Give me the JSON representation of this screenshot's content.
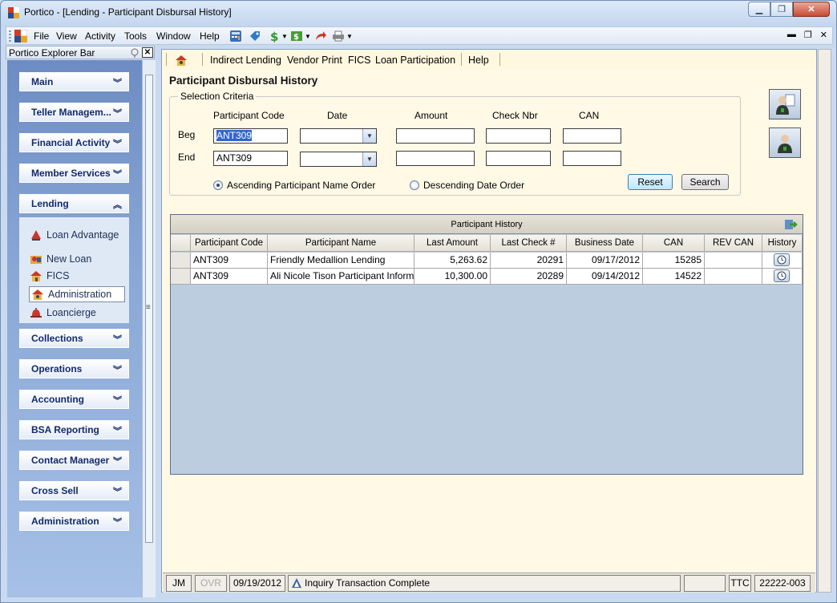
{
  "window": {
    "title": "Portico - [Lending - Participant Disbursal History]"
  },
  "menubar": {
    "items": [
      "File",
      "View",
      "Activity",
      "Tools",
      "Window",
      "Help"
    ]
  },
  "explorer": {
    "title": "Portico Explorer Bar",
    "categories": [
      "Main",
      "Teller Managem...",
      "Financial Activity",
      "Member Services",
      "Lending",
      "Collections",
      "Operations",
      "Accounting",
      "BSA Reporting",
      "Contact Manager",
      "Cross Sell",
      "Administration"
    ],
    "lending_items": [
      "Loan Advantage",
      "New Loan",
      "FICS",
      "Administration",
      "Loancierge"
    ],
    "selected_item": "Administration"
  },
  "toolbar": {
    "items": [
      "Indirect Lending",
      "Vendor Print",
      "FICS",
      "Loan Participation",
      "Help"
    ]
  },
  "page": {
    "title": "Participant Disbursal History"
  },
  "criteria": {
    "legend": "Selection Criteria",
    "col_participant": "Participant Code",
    "col_date": "Date",
    "col_amount": "Amount",
    "col_check": "Check Nbr",
    "col_can": "CAN",
    "row_beg": "Beg",
    "row_end": "End",
    "beg_participant": "ANT309",
    "end_participant": "ANT309",
    "beg_date": "",
    "end_date": "",
    "beg_amount": "",
    "end_amount": "",
    "beg_check": "",
    "end_check": "",
    "beg_can": "",
    "end_can": "",
    "radio_asc": "Ascending Participant Name Order",
    "radio_desc": "Descending Date Order",
    "selected_order": "asc",
    "reset_label": "Reset",
    "search_label": "Search"
  },
  "grid": {
    "caption": "Participant History",
    "columns": [
      "Participant Code",
      "Participant Name",
      "Last Amount",
      "Last Check #",
      "Business Date",
      "CAN",
      "REV CAN",
      "History"
    ],
    "rows": [
      {
        "code": "ANT309",
        "name": "Friendly Medallion Lending",
        "amount": "5,263.62",
        "check": "20291",
        "date": "09/17/2012",
        "can": "15285",
        "rev_can": ""
      },
      {
        "code": "ANT309",
        "name": "Ali Nicole Tison Participant Inform",
        "amount": "10,300.00",
        "check": "20289",
        "date": "09/14/2012",
        "can": "14522",
        "rev_can": ""
      }
    ]
  },
  "status": {
    "user": "JM",
    "ovr": "OVR",
    "date": "09/19/2012",
    "message": "Inquiry Transaction Complete",
    "ttc": "TTC",
    "code": "22222-003"
  },
  "colors": {
    "accent": "#3366cc",
    "content_bg": "#fff9e6",
    "explorer_bg": "#8aa8d6",
    "grid_bg": "#bccde0"
  }
}
